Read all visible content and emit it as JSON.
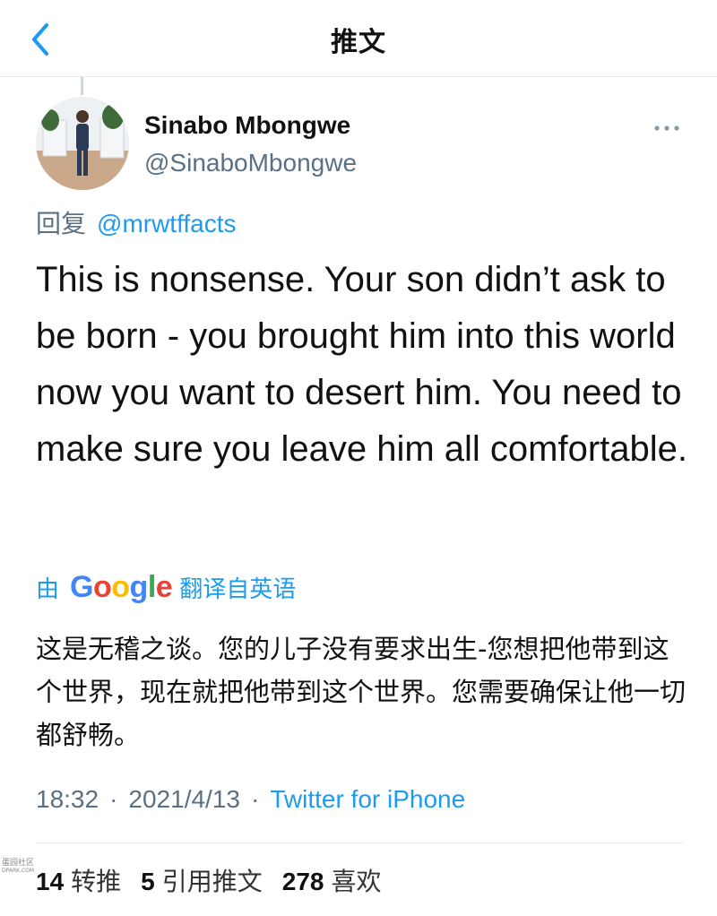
{
  "header": {
    "title": "推文",
    "back_icon": "chevron-left-icon"
  },
  "tweet": {
    "author_name": "Sinabo Mbongwe",
    "author_handle": "@SinaboMbongwe",
    "reply_prefix": "回复",
    "reply_to": "@mrwtffacts",
    "text": "This is nonsense. Your son didn’t ask to be born - you brought him into this world now you want to desert him. You need to make sure you leave him all comfortable.",
    "more_icon": "more-horizontal-icon"
  },
  "translation": {
    "by_label": "由",
    "provider": "Google",
    "from_label": "翻译自英语",
    "text": "这是无稽之谈。您的儿子没有要求出生-您想把他带到这个世界，现在就把他带到这个世界。您需要确保让他一切都舒畅。"
  },
  "meta": {
    "time": "18:32",
    "separator": "·",
    "date": "2021/4/13",
    "source": "Twitter for iPhone"
  },
  "stats": {
    "retweets_count": "14",
    "retweets_label": "转推",
    "quotes_count": "5",
    "quotes_label": "引用推文",
    "likes_count": "278",
    "likes_label": "喜欢"
  },
  "watermark": {
    "line1": "蛋园社区",
    "line2": "DPARK.COM"
  },
  "colors": {
    "accent": "#1d9bf0",
    "secondary_text": "#5b7083",
    "primary_text": "#111111"
  }
}
